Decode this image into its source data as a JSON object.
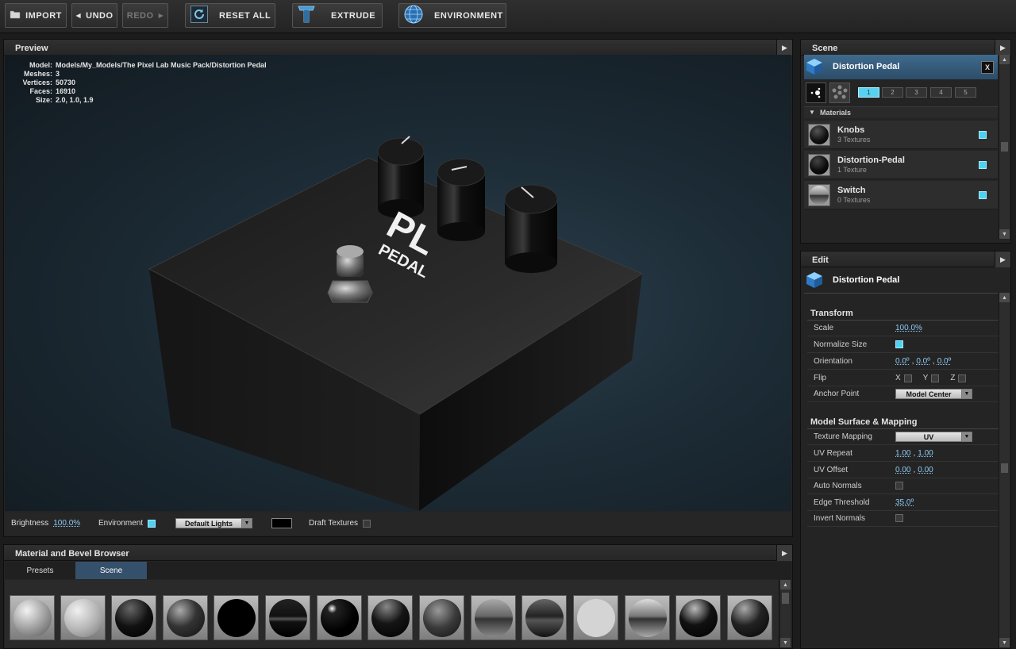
{
  "toolbar": {
    "import_label": "IMPORT",
    "undo_label": "UNDO",
    "redo_label": "REDO",
    "reset_all_label": "RESET ALL",
    "extrude_label": "EXTRUDE",
    "environment_label": "ENVIRONMENT"
  },
  "preview": {
    "title": "Preview",
    "model_info": {
      "model_label": "Model:",
      "model_value": "Models/My_Models/The Pixel Lab Music Pack/Distortion Pedal",
      "meshes_label": "Meshes:",
      "meshes_value": "3",
      "vertices_label": "Vertices:",
      "vertices_value": "50730",
      "faces_label": "Faces:",
      "faces_value": "16910",
      "size_label": "Size:",
      "size_value": "2.0, 1.0, 1.9"
    },
    "logo_text": "PL",
    "logo_sub": "PEDAL",
    "footer": {
      "brightness_label": "Brightness",
      "brightness_value": "100.0%",
      "environment_label": "Environment",
      "lights_value": "Default Lights",
      "draft_textures_label": "Draft Textures"
    }
  },
  "browser": {
    "title": "Material and Bevel Browser",
    "tabs": [
      "Presets",
      "Scene"
    ],
    "active_tab": "Scene"
  },
  "scene": {
    "title": "Scene",
    "object_name": "Distortion Pedal",
    "close_label": "X",
    "layers": [
      "1",
      "2",
      "3",
      "4",
      "5"
    ],
    "materials_label": "Materials",
    "materials": [
      {
        "name": "Knobs",
        "textures": "3 Textures"
      },
      {
        "name": "Distortion-Pedal",
        "textures": "1 Texture"
      },
      {
        "name": "Switch",
        "textures": "0 Textures"
      }
    ]
  },
  "edit": {
    "title": "Edit",
    "object_name": "Distortion Pedal",
    "transform_label": "Transform",
    "scale_label": "Scale",
    "scale_value": "100.0%",
    "normalize_label": "Normalize Size",
    "orientation_label": "Orientation",
    "orientation_x": "0.0º",
    "orientation_y": "0.0º",
    "orientation_z": "0.0º",
    "flip_label": "Flip",
    "flip_x": "X",
    "flip_y": "Y",
    "flip_z": "Z",
    "anchor_label": "Anchor Point",
    "anchor_value": "Model Center",
    "surface_label": "Model Surface & Mapping",
    "texture_mapping_label": "Texture Mapping",
    "texture_mapping_value": "UV",
    "uv_repeat_label": "UV Repeat",
    "uv_repeat_u": "1.00",
    "uv_repeat_v": "1.00",
    "uv_offset_label": "UV Offset",
    "uv_offset_u": "0.00",
    "uv_offset_v": "0.00",
    "auto_normals_label": "Auto Normals",
    "edge_threshold_label": "Edge Threshold",
    "edge_threshold_value": "35.0º",
    "invert_normals_label": "Invert Normals"
  },
  "colors": {
    "accent": "#4fd1f2",
    "link": "#8ec9f2",
    "active_tab": "#35506a"
  }
}
